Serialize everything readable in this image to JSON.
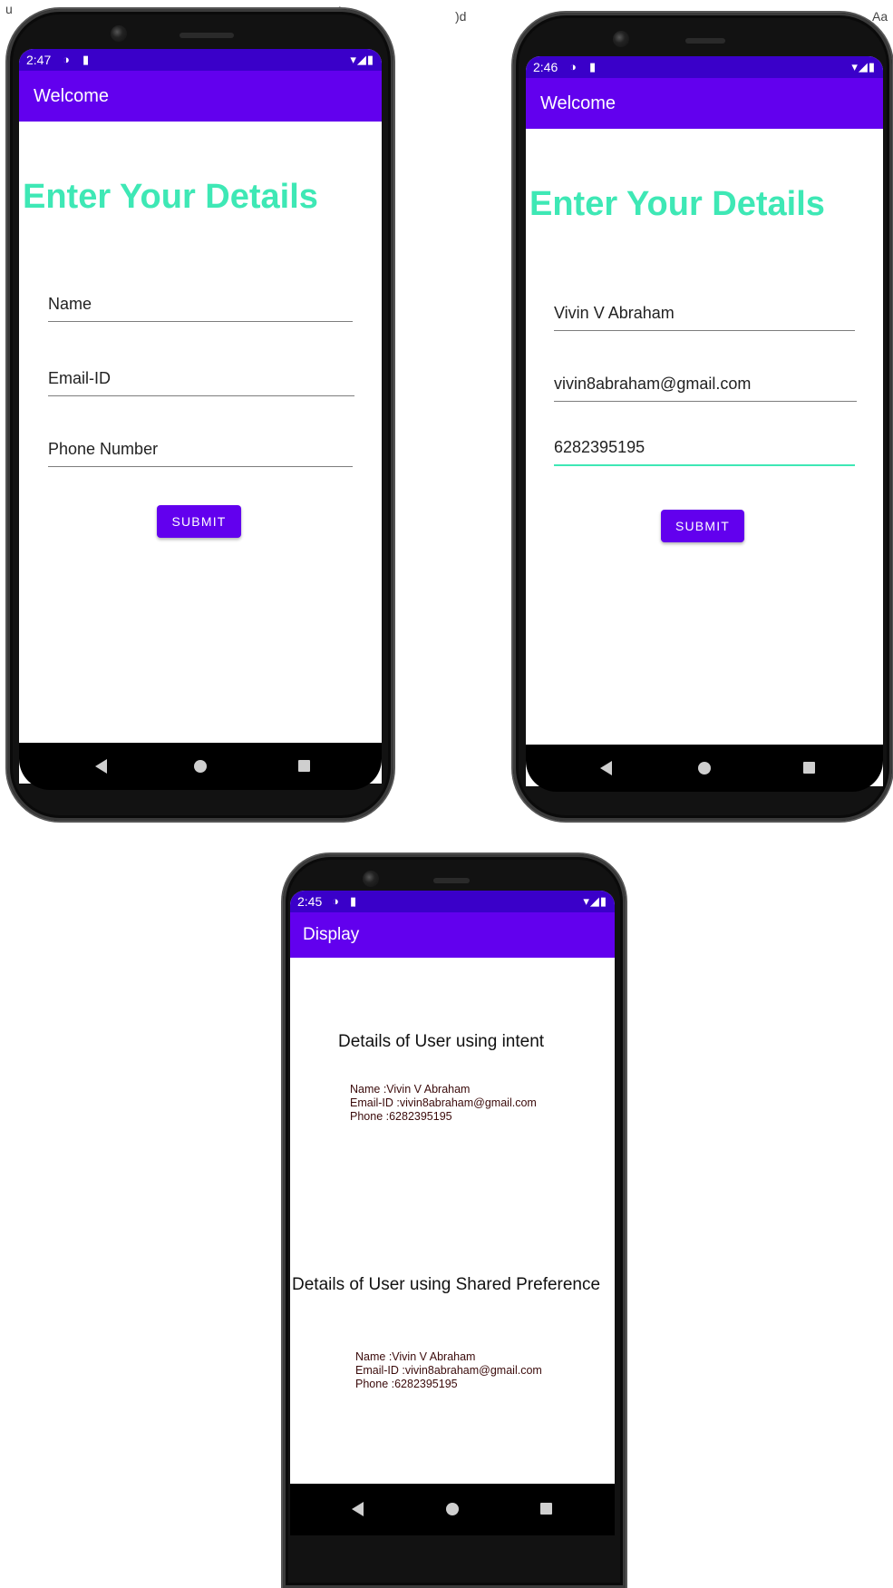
{
  "stray_text": {
    "a": "u",
    "b": "Aa",
    "c": ")d",
    "d": "Aa",
    "e": "Aa"
  },
  "phones": [
    {
      "time": "2:47",
      "appbar_title": "Welcome",
      "headline": "Enter Your Details",
      "fields": [
        "Name",
        "Email-ID",
        "Phone Number"
      ],
      "button": "SUBMIT"
    },
    {
      "time": "2:46",
      "appbar_title": "Welcome",
      "headline": "Enter Your Details",
      "fields": [
        "Vivin V Abraham",
        "vivin8abraham@gmail.com",
        "6282395195"
      ],
      "button": "SUBMIT"
    },
    {
      "time": "2:45",
      "appbar_title": "Display",
      "section1_title": "Details of User using intent",
      "section1_lines": [
        "Name :Vivin V Abraham",
        "Email-ID :vivin8abraham@gmail.com",
        "Phone :6282395195"
      ],
      "section2_title": "Details of User using Shared Preference",
      "section2_lines": [
        "Name :Vivin V Abraham",
        "Email-ID :vivin8abraham@gmail.com",
        "Phone :6282395195"
      ]
    }
  ],
  "icons": {
    "status_left": [
      "data-saver-icon",
      "sd-card-icon"
    ],
    "status_right": [
      "wifi-icon",
      "cell-signal-icon",
      "battery-icon"
    ],
    "nav": [
      "back-icon",
      "home-icon",
      "recents-icon"
    ]
  },
  "colors": {
    "primary": "#6200ee",
    "status": "#3a00c9",
    "headline": "#3ee8b5",
    "focus_underline": "#3ee8b5"
  }
}
